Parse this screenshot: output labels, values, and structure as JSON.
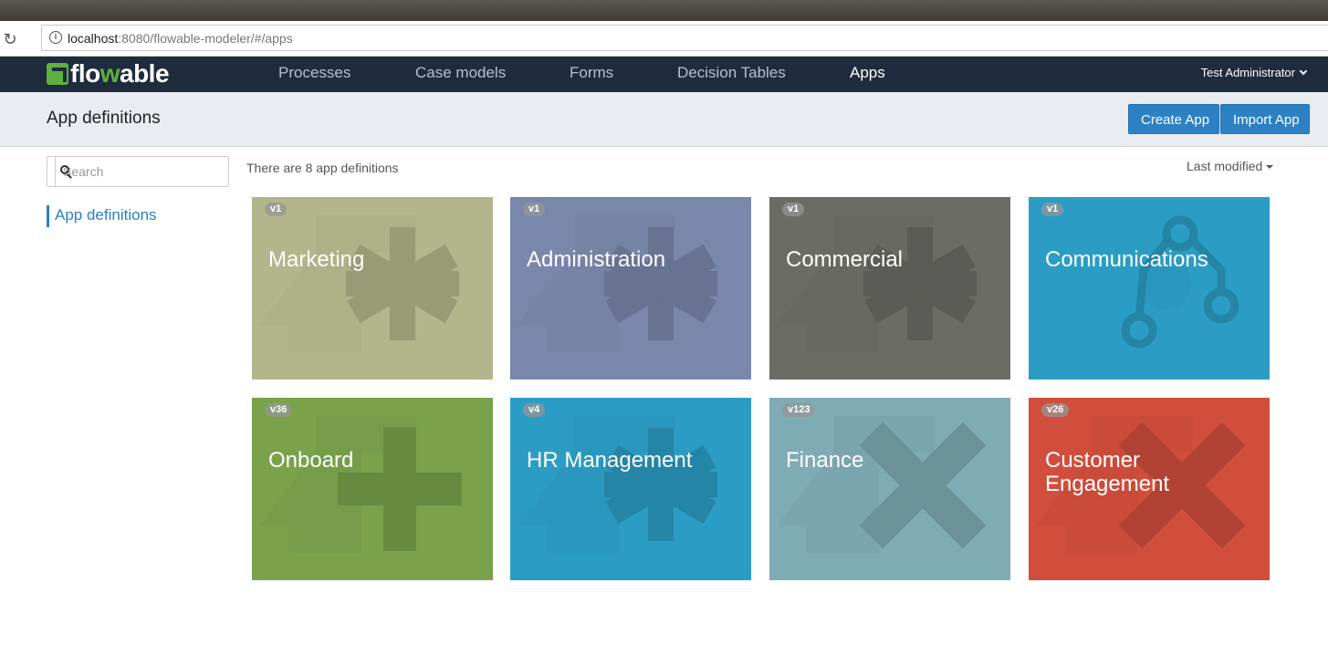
{
  "browser": {
    "url_host": "localhost",
    "url_rest": ":8080/flowable-modeler/#/apps"
  },
  "nav": {
    "logo_pre": "flo",
    "logo_w": "w",
    "logo_post": "able",
    "items": [
      {
        "label": "Processes"
      },
      {
        "label": "Case models"
      },
      {
        "label": "Forms"
      },
      {
        "label": "Decision Tables"
      },
      {
        "label": "Apps"
      }
    ],
    "active": "Apps",
    "user": "Test Administrator"
  },
  "header": {
    "title": "App definitions",
    "create_label": "Create App",
    "import_label": "Import App"
  },
  "sidebar": {
    "search_placeholder": "Search",
    "link": "App definitions"
  },
  "content": {
    "count_text": "There are 8 app definitions",
    "sort_label": "Last modified"
  },
  "colors": {
    "navbar": "#1f2c3e",
    "accent": "#2b81c4",
    "logo_green": "#5fb13f"
  },
  "apps": [
    {
      "name": "Marketing",
      "version": "v1",
      "color": "#b3b68a",
      "icon": "asterisk-icon"
    },
    {
      "name": "Administration",
      "version": "v1",
      "color": "#7987ab",
      "icon": "asterisk-icon"
    },
    {
      "name": "Commercial",
      "version": "v1",
      "color": "#6b6c66",
      "icon": "asterisk-icon"
    },
    {
      "name": "Communications",
      "version": "v1",
      "color": "#2b9dc4",
      "icon": "fork-icon"
    },
    {
      "name": "Onboard",
      "version": "v36",
      "color": "#79a24b",
      "icon": "plus-icon"
    },
    {
      "name": "HR Management",
      "version": "v4",
      "color": "#2b9dc4",
      "icon": "asterisk-icon"
    },
    {
      "name": "Finance",
      "version": "v123",
      "color": "#7eabb4",
      "icon": "cross-icon"
    },
    {
      "name": "Customer Engagement",
      "version": "v26",
      "color": "#d14e3d",
      "icon": "cross-icon"
    }
  ]
}
